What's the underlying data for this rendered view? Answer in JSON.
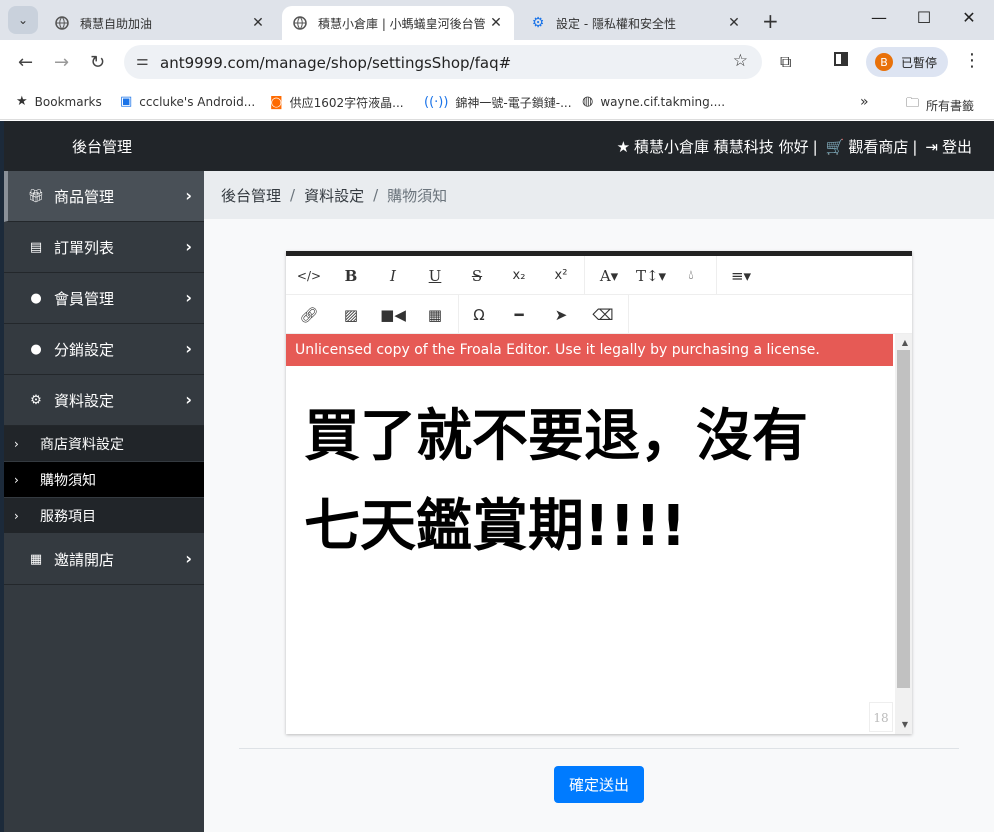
{
  "browser": {
    "tabs": [
      {
        "title": "積慧自助加油",
        "active": false
      },
      {
        "title": "積慧小倉庫 | 小螞蟻皇河後台管",
        "active": true
      },
      {
        "title": "設定 - 隱私權和安全性",
        "active": false
      }
    ],
    "url": "ant9999.com/manage/shop/settingsShop/faq#",
    "profile_initial": "B",
    "profile_label": "已暫停",
    "bookmarks": [
      "Bookmarks",
      "cccluke's Android...",
      "供应1602字符液晶...",
      "錦神一號-電子鎖鏈-...",
      "wayne.cif.takming...."
    ],
    "all_bookmarks": "所有書籤"
  },
  "header": {
    "brand": "後台管理",
    "greeting": "積慧小倉庫 積慧科技 你好",
    "view_shop": "觀看商店",
    "logout": "登出"
  },
  "sidebar": {
    "items": [
      {
        "label": "商品管理",
        "icon": "gift-icon"
      },
      {
        "label": "訂單列表",
        "icon": "file-icon"
      },
      {
        "label": "會員管理",
        "icon": "user-icon"
      },
      {
        "label": "分銷設定",
        "icon": "user-icon"
      },
      {
        "label": "資料設定",
        "icon": "gear-icon"
      }
    ],
    "subitems": [
      "商店資料設定",
      "購物須知",
      "服務項目"
    ],
    "invite": {
      "label": "邀請開店",
      "icon": "qrcode-icon"
    }
  },
  "breadcrumb": [
    "後台管理",
    "資料設定",
    "購物須知"
  ],
  "editor": {
    "warning": "Unlicensed copy of the Froala Editor. Use it legally by purchasing a license.",
    "line1": "買了就不要退，沒有",
    "line2": "七天鑑賞期!!!!",
    "char_count": "18"
  },
  "submit_label": "確定送出"
}
